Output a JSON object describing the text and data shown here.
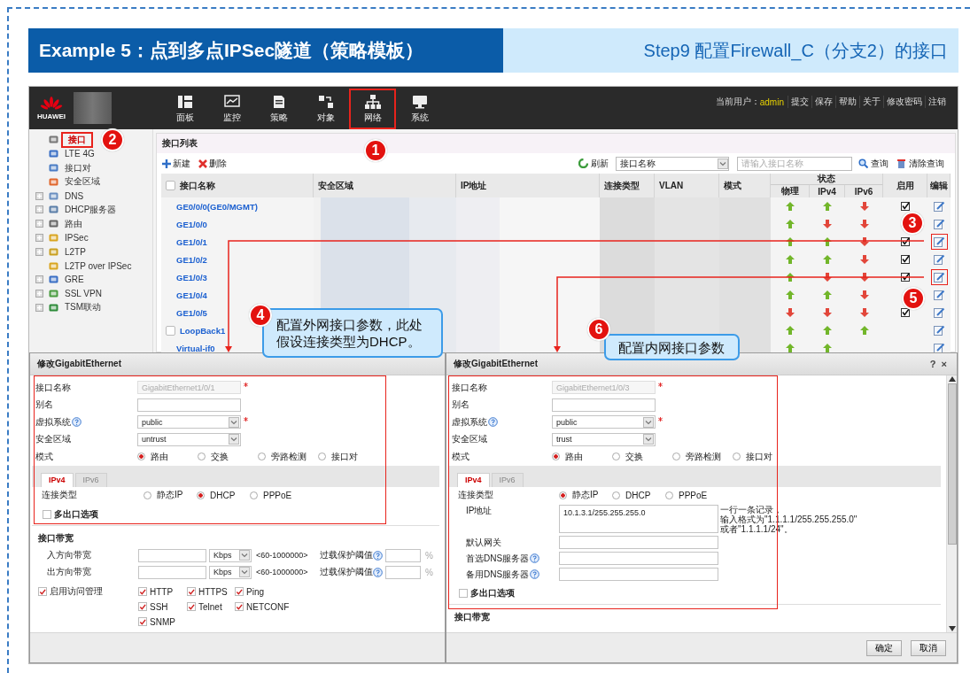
{
  "slide": {
    "title": "Example 5：点到多点IPSec隧道（策略模板）",
    "step": "Step9 配置Firewall_C（分支2）的接口"
  },
  "topbar": {
    "brand": "HUAWEI",
    "nav": [
      {
        "label": "面板",
        "selected": false
      },
      {
        "label": "监控",
        "selected": false
      },
      {
        "label": "策略",
        "selected": false
      },
      {
        "label": "对象",
        "selected": false
      },
      {
        "label": "网络",
        "selected": true
      },
      {
        "label": "系统",
        "selected": false
      }
    ],
    "user_label": "当前用户：",
    "user": "admin",
    "links": [
      "提交",
      "保存",
      "帮助",
      "关于",
      "修改密码",
      "注销"
    ]
  },
  "sidebar": {
    "items": [
      {
        "label": "接口",
        "selected": true,
        "expandable": false
      },
      {
        "label": "LTE 4G",
        "selected": false,
        "expandable": false
      },
      {
        "label": "接口对",
        "selected": false,
        "expandable": false
      },
      {
        "label": "安全区域",
        "selected": false,
        "expandable": false
      },
      {
        "label": "DNS",
        "selected": false,
        "expandable": true
      },
      {
        "label": "DHCP服务器",
        "selected": false,
        "expandable": true
      },
      {
        "label": "路由",
        "selected": false,
        "expandable": true
      },
      {
        "label": "IPSec",
        "selected": false,
        "expandable": true
      },
      {
        "label": "L2TP",
        "selected": false,
        "expandable": true
      },
      {
        "label": "L2TP over IPSec",
        "selected": false,
        "expandable": false
      },
      {
        "label": "GRE",
        "selected": false,
        "expandable": true
      },
      {
        "label": "SSL VPN",
        "selected": false,
        "expandable": true
      },
      {
        "label": "TSM联动",
        "selected": false,
        "expandable": true
      }
    ]
  },
  "list": {
    "title": "接口列表",
    "actions": [
      "新建",
      "删除"
    ],
    "refresh": "刷新",
    "filter": "接口名称",
    "search_placeholder": "请输入接口名称",
    "query": "查询",
    "clear": "清除查询",
    "columns": [
      "接口名称",
      "安全区域",
      "IP地址",
      "连接类型",
      "VLAN",
      "模式"
    ],
    "status": {
      "label": "状态",
      "columns": [
        "物理",
        "IPv4",
        "IPv6"
      ]
    },
    "enable_column": "启用",
    "edit_column": "编辑",
    "select_all_checked": false,
    "rows": [
      {
        "name": "GE0/0/0(GE0/MGMT)",
        "kind": "plain",
        "physical_up": true,
        "ipv4_up": true,
        "ipv6_up": false,
        "enabled": true,
        "marked": false
      },
      {
        "name": "GE1/0/0",
        "kind": "plain",
        "physical_up": true,
        "ipv4_up": false,
        "ipv6_up": false,
        "enabled": false,
        "marked": false
      },
      {
        "name": "GE1/0/1",
        "kind": "plain",
        "physical_up": true,
        "ipv4_up": true,
        "ipv6_up": false,
        "enabled": true,
        "marked": true
      },
      {
        "name": "GE1/0/2",
        "kind": "plain",
        "physical_up": true,
        "ipv4_up": true,
        "ipv6_up": false,
        "enabled": true,
        "marked": false
      },
      {
        "name": "GE1/0/3",
        "kind": "plain",
        "physical_up": true,
        "ipv4_up": false,
        "ipv6_up": false,
        "enabled": true,
        "marked": true
      },
      {
        "name": "GE1/0/4",
        "kind": "plain",
        "physical_up": true,
        "ipv4_up": true,
        "ipv6_up": false,
        "enabled": false,
        "marked": false
      },
      {
        "name": "GE1/0/5",
        "kind": "plain",
        "physical_up": false,
        "ipv4_up": false,
        "ipv6_up": false,
        "enabled": true,
        "marked": false
      },
      {
        "name": "LoopBack1",
        "kind": "checkbox",
        "checked": false,
        "physical_up": true,
        "ipv4_up": true,
        "ipv6_up": true,
        "enabled": false,
        "marked": false
      },
      {
        "name": "Virtual-if0",
        "kind": "plain",
        "physical_up": true,
        "ipv4_up": true,
        "enabled": false,
        "marked": false
      }
    ]
  },
  "dialogs": [
    {
      "title": "修改GigabitEthernet",
      "scrollable": false,
      "fields": [
        {
          "label": "接口名称",
          "kind": "text",
          "value": "GigabitEthernet1/0/1",
          "disabled": true,
          "required": true,
          "help": false
        },
        {
          "label": "别名",
          "kind": "text",
          "disabled": false,
          "required": false,
          "help": false
        },
        {
          "label": "虚拟系统",
          "kind": "select",
          "value": "public",
          "disabled": false,
          "required": true,
          "help": true
        },
        {
          "label": "安全区域",
          "kind": "select",
          "value": "untrust",
          "disabled": false,
          "required": false,
          "help": false
        },
        {
          "label": "模式",
          "kind": "radio",
          "help": false,
          "required": false,
          "options": [
            {
              "label": "路由",
              "selected": true
            },
            {
              "label": "交换",
              "selected": false
            },
            {
              "label": "旁路检测",
              "selected": false
            },
            {
              "label": "接口对",
              "selected": false
            }
          ]
        }
      ],
      "tabs": [
        {
          "label": "IPv4",
          "selected": true
        },
        {
          "label": "IPv6",
          "selected": false
        }
      ],
      "tab_fields": [
        {
          "label": "连接类型",
          "kind": "radio",
          "help": false,
          "options": [
            {
              "label": "静态IP",
              "selected": false
            },
            {
              "label": "DHCP",
              "selected": true
            },
            {
              "label": "PPPoE",
              "selected": false
            }
          ]
        }
      ],
      "multi_exit": {
        "label": "多出口选项",
        "checked": false
      },
      "bandwidth": {
        "title": "接口带宽",
        "rows": [
          {
            "label": "入方向带宽",
            "unit": "Kbps",
            "range": "<60-1000000>",
            "threshold": "过载保护阈值",
            "percent": "%"
          },
          {
            "label": "出方向带宽",
            "unit": "Kbps",
            "range": "<60-1000000>",
            "threshold": "过载保护阈值",
            "percent": "%"
          }
        ]
      },
      "access": {
        "label": "启用访问管理",
        "checked": true,
        "services": [
          {
            "label": "HTTP",
            "checked": true
          },
          {
            "label": "HTTPS",
            "checked": true
          },
          {
            "label": "Ping",
            "checked": true
          },
          {
            "label": "SSH",
            "checked": true
          },
          {
            "label": "Telnet",
            "checked": true
          },
          {
            "label": "NETCONF",
            "checked": true
          },
          {
            "label": "SNMP",
            "checked": true
          }
        ]
      }
    },
    {
      "title": "修改GigabitEthernet",
      "help_button": "?",
      "close_button": "×",
      "scrollable": true,
      "fields": [
        {
          "label": "接口名称",
          "kind": "text",
          "value": "GigabitEthernet1/0/3",
          "disabled": true,
          "required": true,
          "help": false
        },
        {
          "label": "别名",
          "kind": "text",
          "disabled": false,
          "required": false,
          "help": false
        },
        {
          "label": "虚拟系统",
          "kind": "select",
          "value": "public",
          "disabled": false,
          "required": true,
          "help": true
        },
        {
          "label": "安全区域",
          "kind": "select",
          "value": "trust",
          "disabled": false,
          "required": false,
          "help": false
        },
        {
          "label": "模式",
          "kind": "radio",
          "help": false,
          "required": false,
          "options": [
            {
              "label": "路由",
              "selected": true
            },
            {
              "label": "交换",
              "selected": false
            },
            {
              "label": "旁路检测",
              "selected": false
            },
            {
              "label": "接口对",
              "selected": false
            }
          ]
        }
      ],
      "tabs": [
        {
          "label": "IPv4",
          "selected": true
        },
        {
          "label": "IPv6",
          "selected": false
        }
      ],
      "tab_fields": [
        {
          "label": "连接类型",
          "kind": "radio",
          "help": false,
          "options": [
            {
              "label": "静态IP",
              "selected": true
            },
            {
              "label": "DHCP",
              "selected": false
            },
            {
              "label": "PPPoE",
              "selected": false
            }
          ]
        },
        {
          "label": "IP地址",
          "kind": "textarea",
          "help": false,
          "value": "10.1.3.1/255.255.255.0",
          "hint": [
            "一行一条记录，",
            "输入格式为\"1.1.1.1/255.255.255.0\"",
            "或者\"1.1.1.1/24\"。"
          ]
        },
        {
          "label": "默认网关",
          "kind": "text",
          "help": false
        },
        {
          "label": "首选DNS服务器",
          "kind": "text",
          "help": true
        },
        {
          "label": "备用DNS服务器",
          "kind": "text",
          "help": true
        }
      ],
      "multi_exit": {
        "label": "多出口选项",
        "checked": false
      },
      "bandwidth": {
        "title": "接口带宽"
      },
      "buttons": [
        "确定",
        "取消"
      ]
    }
  ],
  "markers": [
    {
      "number": "1"
    },
    {
      "number": "2"
    },
    {
      "number": "3"
    },
    {
      "number": "5"
    }
  ],
  "callouts": [
    {
      "number": "4",
      "lines": [
        "配置外网接口参数，此处",
        "假设连接类型为DHCP。"
      ]
    },
    {
      "number": "6",
      "lines": [
        "配置内网接口参数"
      ]
    }
  ]
}
